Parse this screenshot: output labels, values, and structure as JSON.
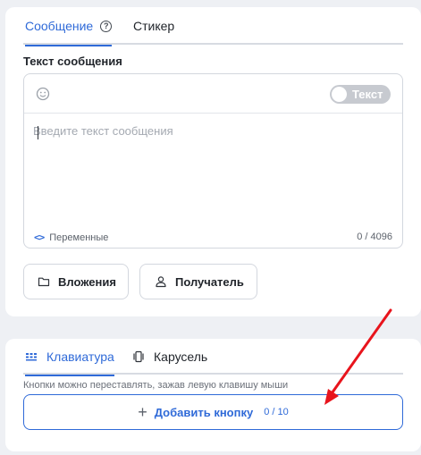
{
  "message_tabs": [
    {
      "label": "Сообщение",
      "active": true
    },
    {
      "label": "Стикер",
      "active": false
    }
  ],
  "help_icon": "question-circle-icon",
  "editor": {
    "section_label": "Текст сообщения",
    "emoji_icon": "smiley-icon",
    "toggle_label": "Текст",
    "toggle_on": false,
    "placeholder": "Введите текст сообщения",
    "variables_label": "Переменные",
    "variables_icon": "code-brackets-icon",
    "char_count": "0 / 4096"
  },
  "actions": {
    "attachments_label": "Вложения",
    "attachments_icon": "folder-icon",
    "recipient_label": "Получатель",
    "recipient_icon": "user-icon"
  },
  "keyboard_tabs": [
    {
      "label": "Клавиатура",
      "active": true,
      "icon": "keyboard-icon"
    },
    {
      "label": "Карусель",
      "active": false,
      "icon": "carousel-icon"
    }
  ],
  "keyboard": {
    "hint": "Кнопки можно переставлять, зажав левую клавишу мыши",
    "add_label": "Добавить кнопку",
    "add_icon": "plus-icon",
    "button_count": "0 / 10"
  },
  "colors": {
    "accent": "#2f6ad8",
    "annotation_arrow": "#e8141c"
  }
}
